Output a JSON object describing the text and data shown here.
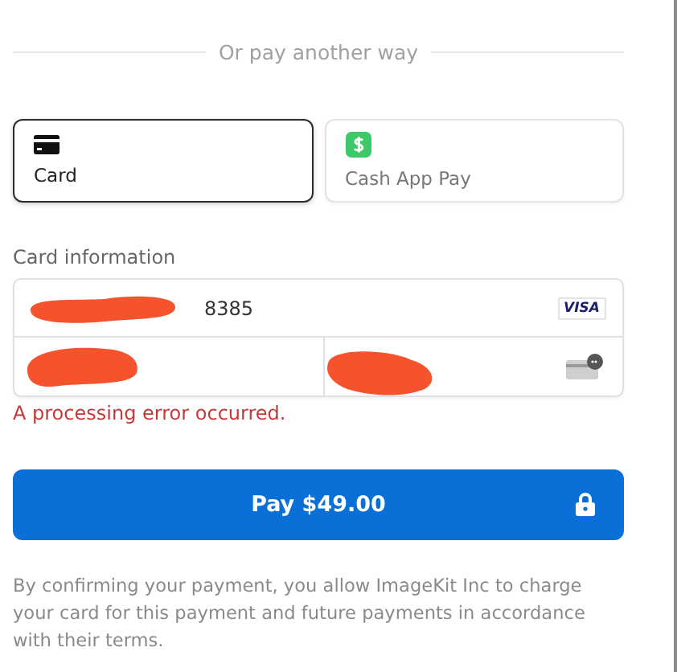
{
  "divider_text": "Or pay another way",
  "tabs": [
    {
      "kind": "card",
      "label": "Card",
      "selected": true
    },
    {
      "kind": "cashapp",
      "label": "Cash App Pay",
      "selected": false
    }
  ],
  "card_info": {
    "label": "Card information",
    "number_suffix": "8385",
    "brand": "VISA",
    "redacted": true
  },
  "error": "A processing error occurred.",
  "pay_button": "Pay $49.00",
  "terms": "By confirming your payment, you allow ImageKit Inc to charge your card for this payment and future payments in accordance with their terms."
}
